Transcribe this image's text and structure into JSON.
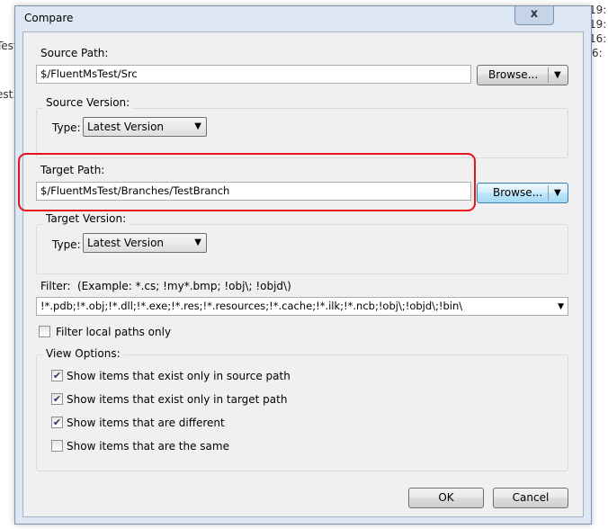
{
  "background": {
    "left_fragments": [
      "Test",
      "est.T"
    ],
    "right_fragments": [
      "19:",
      "19:",
      "16:",
      "6:"
    ]
  },
  "dialog": {
    "title": "Compare",
    "close_glyph": "x",
    "source": {
      "path_label": "Source Path:",
      "path_value": "$/FluentMsTest/Src",
      "browse_label": "Browse...",
      "version_label": "Source Version:",
      "type_label": "Type:",
      "type_value": "Latest Version"
    },
    "target": {
      "path_label": "Target Path:",
      "path_value": "$/FluentMsTest/Branches/TestBranch",
      "browse_label": "Browse...",
      "version_label": "Target Version:",
      "type_label": "Type:",
      "type_value": "Latest Version"
    },
    "filter": {
      "label": "Filter:",
      "example": "(Example: *.cs; !my*.bmp; !obj\\; !objd\\)",
      "value": "!*.pdb;!*.obj;!*.dll;!*.exe;!*.res;!*.resources;!*.cache;!*.ilk;!*.ncb;!obj\\;!objd\\;!bin\\"
    },
    "filter_local_only": {
      "label": "Filter local paths only",
      "checked": false
    },
    "view_options": {
      "label": "View Options:",
      "items": [
        {
          "label": "Show items that exist only in source path",
          "checked": true
        },
        {
          "label": "Show items that exist only in target path",
          "checked": true
        },
        {
          "label": "Show items that are different",
          "checked": true
        },
        {
          "label": "Show items that are the same",
          "checked": false
        }
      ]
    },
    "ok_label": "OK",
    "cancel_label": "Cancel",
    "highlight_color": "#e8141d"
  }
}
